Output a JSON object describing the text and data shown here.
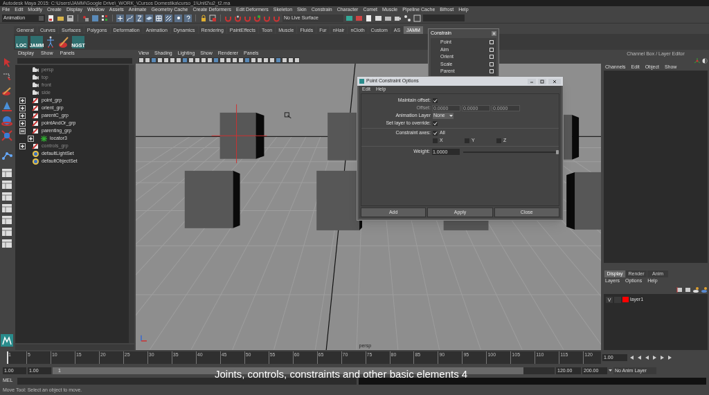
{
  "window": {
    "title": "Autodesk Maya 2015: C:\\Users\\JAMM\\Google Drive\\_WORK_\\Cursos Domestika\\curso_1\\Unit2\\u2_t2.ma"
  },
  "menu_bar": [
    "File",
    "Edit",
    "Modify",
    "Create",
    "Display",
    "Window",
    "Assets",
    "Animate",
    "Geometry Cache",
    "Create Deformers",
    "Edit Deformers",
    "Skeleton",
    "Skin",
    "Constrain",
    "Character",
    "Comet",
    "Muscle",
    "Pipeline Cache",
    "Bifrost",
    "Help"
  ],
  "status_line": {
    "mode": "Animation",
    "live_surface": "No Live Surface"
  },
  "shelf": {
    "tabs": [
      {
        "label": "General",
        "selected": false
      },
      {
        "label": "Curves",
        "selected": false
      },
      {
        "label": "Surfaces",
        "selected": false
      },
      {
        "label": "Polygons",
        "selected": false
      },
      {
        "label": "Deformation",
        "selected": false
      },
      {
        "label": "Animation",
        "selected": false
      },
      {
        "label": "Dynamics",
        "selected": false
      },
      {
        "label": "Rendering",
        "selected": false
      },
      {
        "label": "PaintEffects",
        "selected": false
      },
      {
        "label": "Toon",
        "selected": false
      },
      {
        "label": "Muscle",
        "selected": false
      },
      {
        "label": "Fluids",
        "selected": false
      },
      {
        "label": "Fur",
        "selected": false
      },
      {
        "label": "nHair",
        "selected": false
      },
      {
        "label": "nCloth",
        "selected": false
      },
      {
        "label": "Custom",
        "selected": false
      },
      {
        "label": "AS",
        "selected": false
      },
      {
        "label": "JAMM",
        "selected": true
      }
    ],
    "items": [
      {
        "kind": "labeled",
        "label": "LOC"
      },
      {
        "kind": "labeled",
        "label": "JAMM"
      },
      {
        "kind": "skeleton"
      },
      {
        "kind": "brush"
      },
      {
        "kind": "labeled",
        "label": "NGST"
      }
    ]
  },
  "outliner": {
    "menu": [
      "Display",
      "Show",
      "Panels"
    ],
    "items": [
      {
        "kind": "camera",
        "label": "persp",
        "dimmed": true
      },
      {
        "kind": "camera",
        "label": "top",
        "dimmed": true
      },
      {
        "kind": "camera",
        "label": "front",
        "dimmed": true
      },
      {
        "kind": "camera",
        "label": "side",
        "dimmed": true
      },
      {
        "kind": "group",
        "label": "point_grp",
        "dimmed": false,
        "expanded": false
      },
      {
        "kind": "group",
        "label": "orient_grp",
        "dimmed": false,
        "expanded": false
      },
      {
        "kind": "group",
        "label": "parentC_grp",
        "dimmed": false,
        "expanded": false
      },
      {
        "kind": "group",
        "label": "pointAndOr_grp",
        "dimmed": false,
        "expanded": false
      },
      {
        "kind": "group",
        "label": "parenting_grp",
        "dimmed": false,
        "expanded": true,
        "children": [
          {
            "kind": "locator",
            "label": "locator3",
            "dimmed": false,
            "expanded": false
          }
        ]
      },
      {
        "kind": "group",
        "label": "controls_grp",
        "dimmed": true,
        "expanded": false
      },
      {
        "kind": "set",
        "label": "defaultLightSet",
        "dimmed": false
      },
      {
        "kind": "set",
        "label": "defaultObjectSet",
        "dimmed": false
      }
    ]
  },
  "viewport": {
    "menu": [
      "View",
      "Shading",
      "Lighting",
      "Show",
      "Renderer",
      "Panels"
    ],
    "camera_label": "persp"
  },
  "constrain_menu": {
    "title": "Constrain",
    "items": [
      "Point",
      "Aim",
      "Orient",
      "Scale",
      "Parent"
    ]
  },
  "dialog": {
    "title": "Point Constraint Options",
    "menu": [
      "Edit",
      "Help"
    ],
    "maintain_offset": {
      "label": "Maintain offset:",
      "checked": true
    },
    "offset": {
      "label": "Offset:",
      "values": [
        "0.0000",
        "0.0000",
        "0.0000"
      ],
      "disabled": true
    },
    "animation_layer": {
      "label": "Animation Layer",
      "value": "None"
    },
    "override": {
      "label": "Set layer to override:",
      "checked": true
    },
    "axes": {
      "label": "Constraint axes:",
      "items": [
        {
          "label": "All",
          "checked": true
        },
        {
          "label": "X",
          "checked": false
        },
        {
          "label": "Y",
          "checked": false
        },
        {
          "label": "Z",
          "checked": false
        }
      ]
    },
    "weight": {
      "label": "Weight:",
      "value": "1.0000",
      "level": 1
    },
    "buttons": [
      "Add",
      "Apply",
      "Close"
    ]
  },
  "channel_box": {
    "title": "Channel Box / Layer Editor",
    "menu": [
      "Channels",
      "Edit",
      "Object",
      "Show"
    ]
  },
  "layer_editor": {
    "tabs": [
      {
        "label": "Display",
        "selected": true
      },
      {
        "label": "Render",
        "selected": false
      },
      {
        "label": "Anim",
        "selected": false
      }
    ],
    "menu": [
      "Layers",
      "Options",
      "Help"
    ],
    "layers": [
      {
        "visibility": "V",
        "name": "layer1",
        "color": "#ff0000"
      }
    ]
  },
  "time_slider": {
    "ticks": [
      "1",
      "5",
      "10",
      "15",
      "20",
      "25",
      "30",
      "35",
      "40",
      "45",
      "50",
      "55",
      "60",
      "65",
      "70",
      "75",
      "80",
      "85",
      "90",
      "95",
      "100",
      "105",
      "110",
      "115",
      "120"
    ],
    "current": "1.00",
    "level": 0
  },
  "range_slider": {
    "start": "1.00",
    "playback_start": "1.00",
    "bar_label": "1",
    "playback_end": "120.00",
    "end": "200.00",
    "anim_layer": "No Anim Layer"
  },
  "command_line": {
    "label": "MEL"
  },
  "help_line": "Move Tool: Select an object to move.",
  "caption": "Joints, controls, constraints and other basic elements 4"
}
